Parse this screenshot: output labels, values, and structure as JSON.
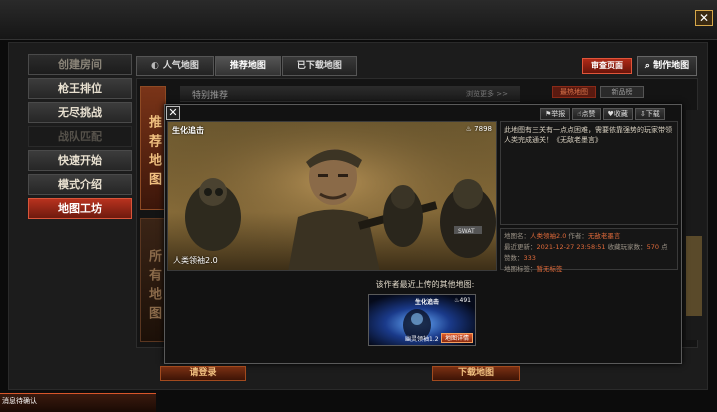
{
  "menu": {
    "items": [
      {
        "label": "创建房间",
        "state": "dim"
      },
      {
        "label": "枪王排位",
        "state": "normal"
      },
      {
        "label": "无尽挑战",
        "state": "normal"
      },
      {
        "label": "战队匹配",
        "state": "disabled"
      },
      {
        "label": "快速开始",
        "state": "normal"
      },
      {
        "label": "模式介绍",
        "state": "normal"
      },
      {
        "label": "地图工坊",
        "state": "active"
      }
    ]
  },
  "tabs": [
    {
      "label": "人气地图",
      "icon": "popular-icon"
    },
    {
      "label": "推荐地图",
      "active": true
    },
    {
      "label": "已下载地图"
    }
  ],
  "toolbar": {
    "review_label": "审查页面",
    "make_label": "制作地图"
  },
  "sidebar": {
    "recommended": "推荐地图",
    "all": "所有地图"
  },
  "special": {
    "title": "特别推荐",
    "more": "浏览更多 >>"
  },
  "filters": [
    "最热地图",
    "新品榜"
  ],
  "popup": {
    "preview": {
      "mode": "生化追击",
      "likes": "7898",
      "map_name": "人类领袖2.0"
    },
    "actions": [
      "举报",
      "点赞",
      "收藏",
      "下载"
    ],
    "description": "此地图有三关有一点点困难，需要依靠强势的玩家带领人类完成通关！《无敌老墨言》",
    "info": {
      "name_key": "地图名：",
      "name_val": "人类领袖2.0",
      "author_key": "作者：",
      "author_val": "无敌老墨言",
      "updated_key": "最近更新：",
      "updated_val": "2021-12-27 23:58:51",
      "fav_key": "收藏玩家数：",
      "fav_val": "570",
      "likes_key": "点赞数：",
      "likes_val": "333",
      "tags_key": "地图标签：",
      "tags_val": "暂无标签"
    },
    "other_title": "该作者最近上传的其他地图:",
    "other_map": {
      "mode": "生化追击",
      "likes": "491",
      "name": "幽灵领袖1.2",
      "detail_label": "地图详情"
    }
  },
  "footer": {
    "login_label": "请登录",
    "download_label": "下载地图",
    "message": "消息待确认"
  },
  "colors": {
    "accent_red": "#b8321e",
    "highlight_orange": "#e06a3a"
  }
}
